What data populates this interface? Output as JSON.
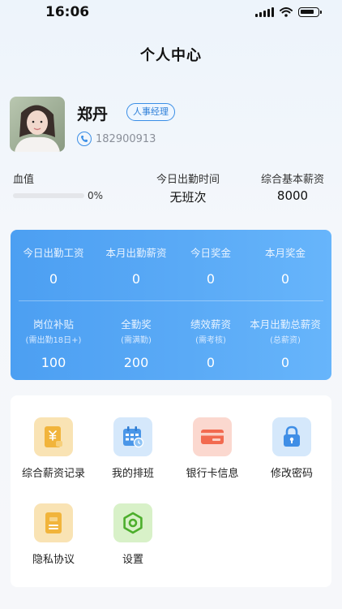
{
  "status_bar": {
    "time": "16:06"
  },
  "page": {
    "title": "个人中心"
  },
  "profile": {
    "name": "郑丹",
    "role": "人事经理",
    "phone": "182900913"
  },
  "stats": {
    "health": {
      "label": "血值",
      "percent_text": "0%",
      "value": 0
    },
    "today_time": {
      "label": "今日出勤时间",
      "value": "无班次"
    },
    "base_salary": {
      "label": "综合基本薪资",
      "value": "8000"
    }
  },
  "salary_card": {
    "row1": [
      {
        "label": "今日出勤工资",
        "value": "0"
      },
      {
        "label": "本月出勤薪资",
        "value": "0"
      },
      {
        "label": "今日奖金",
        "value": "0"
      },
      {
        "label": "本月奖金",
        "value": "0"
      }
    ],
    "row2": [
      {
        "label": "岗位补贴",
        "sub": "(需出勤18日+)",
        "value": "100"
      },
      {
        "label": "全勤奖",
        "sub": "(需满勤)",
        "value": "200"
      },
      {
        "label": "绩效薪资",
        "sub": "(需考核)",
        "value": "0"
      },
      {
        "label": "本月出勤总薪资",
        "sub": "(总薪资)",
        "value": "0"
      }
    ]
  },
  "menu": {
    "items": [
      {
        "label": "综合薪资记录",
        "icon": "salary-record-icon",
        "color": "#f9e3b4"
      },
      {
        "label": "我的排班",
        "icon": "calendar-icon",
        "color": "#d5e8fb"
      },
      {
        "label": "银行卡信息",
        "icon": "bank-card-icon",
        "color": "#fbd8cf"
      },
      {
        "label": "修改密码",
        "icon": "lock-icon",
        "color": "#d5e8fb"
      },
      {
        "label": "隐私协议",
        "icon": "document-icon",
        "color": "#f9e3b4"
      },
      {
        "label": "设置",
        "icon": "gear-icon",
        "color": "#d8f1c8"
      }
    ]
  }
}
